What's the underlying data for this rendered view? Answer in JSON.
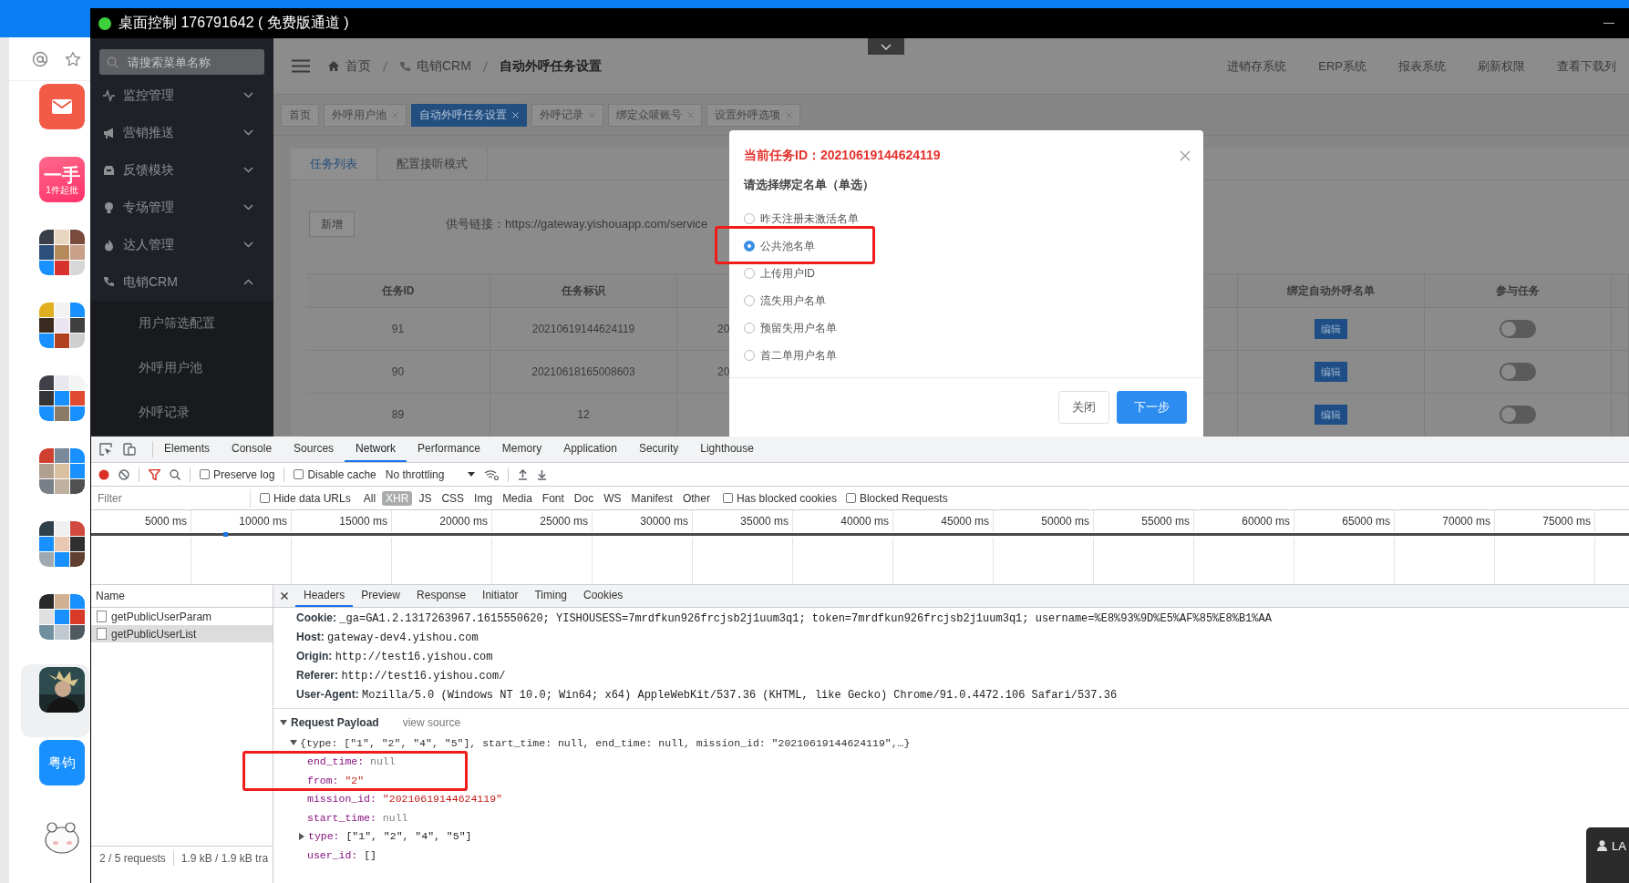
{
  "chat_sidebar": {
    "items": [
      {
        "kind": "mail",
        "selected": false
      },
      {
        "kind": "brand",
        "title": "一手",
        "subtitle": "1件起批",
        "selected": false
      },
      {
        "kind": "group",
        "selected": false
      },
      {
        "kind": "group",
        "selected": false
      },
      {
        "kind": "group",
        "selected": false
      },
      {
        "kind": "group",
        "selected": false
      },
      {
        "kind": "group",
        "selected": false
      },
      {
        "kind": "group",
        "selected": false
      },
      {
        "kind": "avatar",
        "selected": true
      },
      {
        "kind": "text",
        "label": "粤钧",
        "selected": false
      },
      {
        "kind": "sticker",
        "selected": false
      }
    ]
  },
  "remote_window": {
    "title": "桌面控制 176791642 ( 免费版通道 )",
    "online": true
  },
  "web_app": {
    "sidebar": {
      "search_placeholder": "请搜索菜单名称",
      "menu": [
        {
          "label": "监控管理",
          "expanded": false
        },
        {
          "label": "营销推送",
          "expanded": false
        },
        {
          "label": "反馈模块",
          "expanded": false
        },
        {
          "label": "专场管理",
          "expanded": false
        },
        {
          "label": "达人管理",
          "expanded": false
        },
        {
          "label": "电销CRM",
          "expanded": true,
          "children": [
            {
              "label": "用户筛选配置"
            },
            {
              "label": "外呼用户池"
            },
            {
              "label": "外呼记录"
            }
          ]
        }
      ]
    },
    "breadcrumb": [
      "首页",
      "电销CRM",
      "自动外呼任务设置"
    ],
    "header_links": [
      "进销存系统",
      "ERP系统",
      "报表系统",
      "刷新权限",
      "查看下载列"
    ],
    "tabs": [
      {
        "label": "首页",
        "closable": false,
        "selected": false
      },
      {
        "label": "外呼用户池",
        "closable": true,
        "selected": false
      },
      {
        "label": "自动外呼任务设置",
        "closable": true,
        "selected": true
      },
      {
        "label": "外呼记录",
        "closable": true,
        "selected": false
      },
      {
        "label": "绑定众唛账号",
        "closable": true,
        "selected": false
      },
      {
        "label": "设置外呼选项",
        "closable": true,
        "selected": false
      }
    ],
    "sub_tabs": [
      {
        "label": "任务列表",
        "selected": true
      },
      {
        "label": "配置接听模式",
        "selected": false
      }
    ],
    "add_button": "新增",
    "supply_link": "供号链接：https://gateway.yishouapp.com/service",
    "table": {
      "columns": {
        "task_id": "任务ID",
        "task_tag": "任务标识",
        "bind_list": "绑定自动外呼名单",
        "participate": "参与任务"
      },
      "rows": [
        {
          "task_id": "91",
          "task_tag": "20210619144624119",
          "column_3": "20",
          "edit_button": "编辑",
          "participating": false
        },
        {
          "task_id": "90",
          "task_tag": "20210618165008603",
          "column_3": "20",
          "edit_button": "编辑",
          "participating": false
        },
        {
          "task_id": "89",
          "task_tag": "12",
          "edit_button": "编辑",
          "participating": false
        }
      ]
    }
  },
  "modal": {
    "title": "当前任务ID：20210619144624119",
    "prompt": "请选择绑定名单（单选）",
    "options": [
      {
        "label": "昨天注册未激活名单",
        "selected": false
      },
      {
        "label": "公共池名单",
        "selected": true
      },
      {
        "label": "上传用户ID",
        "selected": false
      },
      {
        "label": "流失用户名单",
        "selected": false
      },
      {
        "label": "预留失用户名单",
        "selected": false
      },
      {
        "label": "首二单用户名单",
        "selected": false
      }
    ],
    "buttons": [
      {
        "label": "关闭",
        "kind": "default"
      },
      {
        "label": "下一步",
        "kind": "primary"
      }
    ]
  },
  "annotations": [
    {
      "kind": "rectangle"
    },
    {
      "kind": "rectangle"
    }
  ],
  "devtools": {
    "panel_tabs": [
      {
        "label": "Elements",
        "selected": false
      },
      {
        "label": "Console",
        "selected": false
      },
      {
        "label": "Sources",
        "selected": false
      },
      {
        "label": "Network",
        "selected": true
      },
      {
        "label": "Performance",
        "selected": false
      },
      {
        "label": "Memory",
        "selected": false
      },
      {
        "label": "Application",
        "selected": false
      },
      {
        "label": "Security",
        "selected": false
      },
      {
        "label": "Lighthouse",
        "selected": false
      }
    ],
    "preserve_log": {
      "label": "Preserve log",
      "checked": false
    },
    "disable_cache": {
      "label": "Disable cache",
      "checked": false
    },
    "throttling": "No throttling",
    "filter_placeholder": "Filter",
    "hide_data_urls": {
      "label": "Hide data URLs",
      "checked": false
    },
    "resource_types": [
      {
        "label": "All",
        "selected": false
      },
      {
        "label": "XHR",
        "selected": true
      },
      {
        "label": "JS",
        "selected": false
      },
      {
        "label": "CSS",
        "selected": false
      },
      {
        "label": "Img",
        "selected": false
      },
      {
        "label": "Media",
        "selected": false
      },
      {
        "label": "Font",
        "selected": false
      },
      {
        "label": "Doc",
        "selected": false
      },
      {
        "label": "WS",
        "selected": false
      },
      {
        "label": "Manifest",
        "selected": false
      },
      {
        "label": "Other",
        "selected": false
      }
    ],
    "has_blocked_cookies": {
      "label": "Has blocked cookies",
      "checked": false
    },
    "blocked_requests": {
      "label": "Blocked Requests",
      "checked": false
    },
    "timeline_ticks": [
      "5000 ms",
      "10000 ms",
      "15000 ms",
      "20000 ms",
      "25000 ms",
      "30000 ms",
      "35000 ms",
      "40000 ms",
      "45000 ms",
      "50000 ms",
      "55000 ms",
      "60000 ms",
      "65000 ms",
      "70000 ms",
      "75000 ms"
    ],
    "name_column": "Name",
    "requests": [
      {
        "name": "getPublicUserParam",
        "selected": false
      },
      {
        "name": "getPublicUserList",
        "selected": true
      }
    ],
    "summary": [
      "2 / 5 requests",
      "1.9 kB / 1.9 kB tra"
    ],
    "detail_tabs": [
      {
        "label": "Headers",
        "selected": true
      },
      {
        "label": "Preview",
        "selected": false
      },
      {
        "label": "Response",
        "selected": false
      },
      {
        "label": "Initiator",
        "selected": false
      },
      {
        "label": "Timing",
        "selected": false
      },
      {
        "label": "Cookies",
        "selected": false
      }
    ],
    "request_headers": [
      {
        "key": "Cookie:",
        "value": "_ga=GA1.2.1317263967.1615550620; YISHOUSESS=7mrdfkun926frcjsb2j1uum3q1; token=7mrdfkun926frcjsb2j1uum3q1; username=%E8%93%9D%E5%AF%85%E8%B1%AA"
      },
      {
        "key": "Host:",
        "value": "gateway-dev4.yishou.com"
      },
      {
        "key": "Origin:",
        "value": "http://test16.yishou.com"
      },
      {
        "key": "Referer:",
        "value": "http://test16.yishou.com/"
      },
      {
        "key": "User-Agent:",
        "value": "Mozilla/5.0 (Windows NT 10.0; Win64; x64) AppleWebKit/537.36 (KHTML, like Gecko) Chrome/91.0.4472.106 Safari/537.36"
      }
    ],
    "payload": {
      "title": "Request Payload",
      "view_source": "view source",
      "expanded": true,
      "summary": "{type: [\"1\", \"2\", \"4\", \"5\"], start_time: null, end_time: null, mission_id: \"20210619144624119\",…}",
      "summary_expanded": true,
      "properties": [
        {
          "key": "end_time:",
          "value": "null",
          "kind": "null"
        },
        {
          "key": "from:",
          "value": "\"2\"",
          "kind": "string"
        },
        {
          "key": "mission_id:",
          "value": "\"20210619144624119\"",
          "kind": "string"
        },
        {
          "key": "start_time:",
          "value": "null",
          "kind": "null"
        },
        {
          "key": "type:",
          "value": "[\"1\", \"2\", \"4\", \"5\"]",
          "kind": "array",
          "expanded": false
        },
        {
          "key": "user_id:",
          "value": "[]",
          "kind": "array"
        }
      ]
    }
  },
  "popup": {
    "text": "LA"
  }
}
